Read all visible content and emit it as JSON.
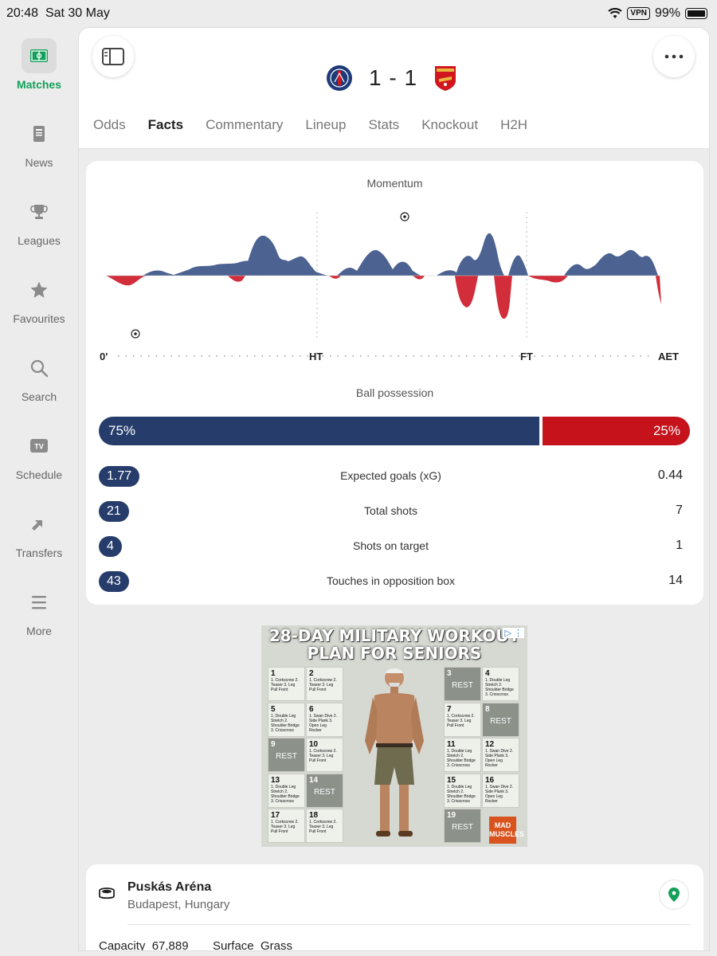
{
  "status_bar": {
    "time": "20:48",
    "date": "Sat 30 May",
    "vpn": "VPN",
    "battery": "99%"
  },
  "sidebar": {
    "items": [
      {
        "label": "Matches",
        "icon": "pitch-icon",
        "active": true
      },
      {
        "label": "News",
        "icon": "news-icon"
      },
      {
        "label": "Leagues",
        "icon": "trophy-icon"
      },
      {
        "label": "Favourites",
        "icon": "star-icon"
      },
      {
        "label": "Search",
        "icon": "search-icon"
      },
      {
        "label": "Schedule",
        "icon": "tv-icon"
      },
      {
        "label": "Transfers",
        "icon": "transfer-arrows-icon"
      },
      {
        "label": "More",
        "icon": "menu-icon"
      }
    ]
  },
  "match": {
    "score": "1 - 1",
    "home_crest_color": "#1e3a78",
    "away_crest_color": "#d1161e"
  },
  "tabs": [
    "Odds",
    "Facts",
    "Commentary",
    "Lineup",
    "Stats",
    "Knockout",
    "H2H"
  ],
  "active_tab": "Facts",
  "momentum": {
    "title": "Momentum",
    "axis": [
      "0'",
      "HT",
      "FT",
      "AET"
    ],
    "home_color": "#4c6291",
    "away_color": "#d12d3a"
  },
  "possession": {
    "title": "Ball possession",
    "home": "75%",
    "away": "25%",
    "home_fraction": 0.75
  },
  "stats": [
    {
      "home": "1.77",
      "label": "Expected goals (xG)",
      "away": "0.44"
    },
    {
      "home": "21",
      "label": "Total shots",
      "away": "7"
    },
    {
      "home": "4",
      "label": "Shots on target",
      "away": "1"
    },
    {
      "home": "43",
      "label": "Touches in opposition box",
      "away": "14"
    }
  ],
  "ad": {
    "title_line1": "28-DAY MILITARY WORKOUT",
    "title_line2": "PLAN FOR SENIORS",
    "brand": "MAD MUSCLES",
    "rest": "REST",
    "days_left": [
      {
        "n": "1",
        "t": "1. Corkscrew 2. Teaser 3. Leg Pull Front"
      },
      {
        "n": "2",
        "t": "1. Corkscrew 2. Teaser 3. Leg Pull Front"
      },
      {
        "n": "5",
        "t": "1. Double Leg Stretch 2. Shoulder Bridge 3. Crisscross"
      },
      {
        "n": "6",
        "t": "1. Swan Dive 2. Side Plank 3. Open Leg Rocker"
      },
      {
        "n": "9",
        "rest": true
      },
      {
        "n": "10",
        "t": "1. Corkscrew 2. Teaser 3. Leg Pull Front"
      },
      {
        "n": "13",
        "t": "1. Double Leg Stretch 2. Shoulder Bridge 3. Crisscross"
      },
      {
        "n": "14",
        "rest": true
      },
      {
        "n": "17",
        "t": "1. Corkscrew 2. Teaser 3. Leg Pull Front"
      },
      {
        "n": "18",
        "t": "1. Corkscrew 2. Teaser 3. Leg Pull Front"
      }
    ],
    "days_right": [
      {
        "n": "3",
        "rest": true
      },
      {
        "n": "4",
        "t": "1. Double Leg Stretch 2. Shoulder Bridge 3. Crisscross"
      },
      {
        "n": "7",
        "t": "1. Corkscrew 2. Teaser 3. Leg Pull Front"
      },
      {
        "n": "8",
        "rest": true
      },
      {
        "n": "11",
        "t": "1. Double Leg Stretch 2. Shoulder Bridge 3. Crisscross"
      },
      {
        "n": "12",
        "t": "1. Swan Dive 2. Side Plank 3. Open Leg Rocker"
      },
      {
        "n": "15",
        "t": "1. Double Leg Stretch 2. Shoulder Bridge 3. Crisscross"
      },
      {
        "n": "16",
        "t": "1. Swan Dive 2. Side Plank 3. Open Leg Rocker"
      },
      {
        "n": "19",
        "rest": true
      }
    ]
  },
  "venue": {
    "name": "Puskás Aréna",
    "city": "Budapest, Hungary",
    "capacity_label": "Capacity",
    "capacity": "67,889",
    "surface_label": "Surface",
    "surface": "Grass"
  }
}
